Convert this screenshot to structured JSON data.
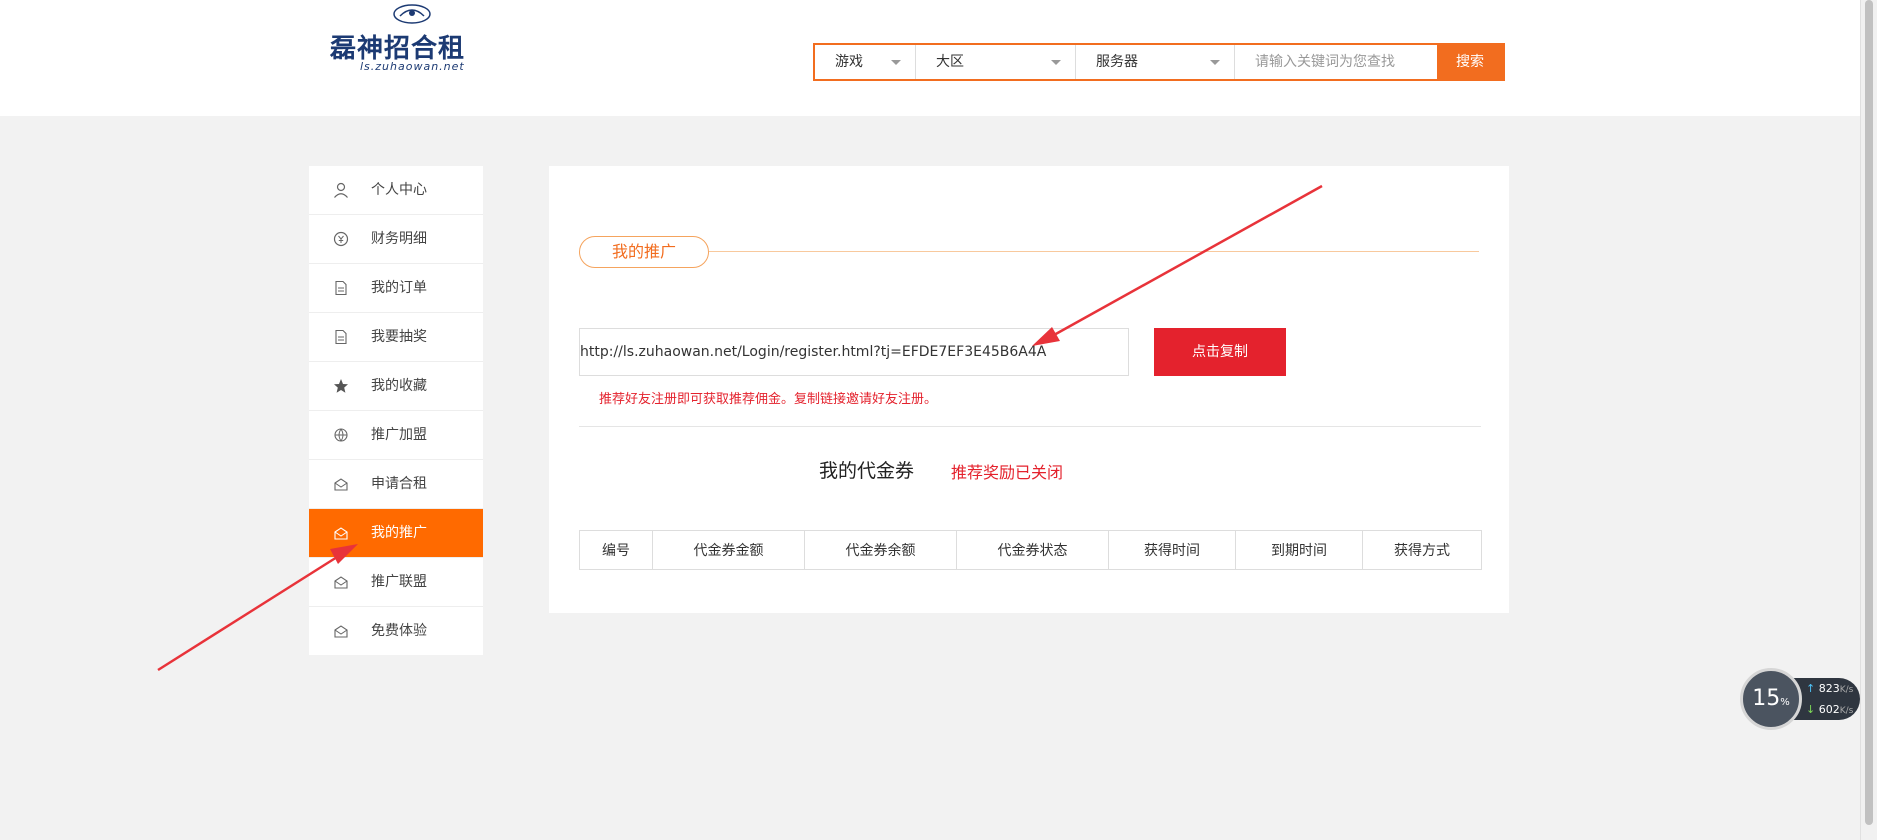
{
  "logo": {
    "text": "磊神招合租",
    "domain": "ls.zuhaowan.net"
  },
  "search": {
    "filters": [
      {
        "label": "游戏"
      },
      {
        "label": "大区"
      },
      {
        "label": "服务器"
      }
    ],
    "placeholder": "请输入关键词为您查找",
    "button": "搜索"
  },
  "sidebar": {
    "items": [
      {
        "label": "个人中心",
        "icon": "user-icon"
      },
      {
        "label": "财务明细",
        "icon": "money-icon"
      },
      {
        "label": "我的订单",
        "icon": "document-icon"
      },
      {
        "label": "我要抽奖",
        "icon": "document-icon"
      },
      {
        "label": "我的收藏",
        "icon": "star-icon"
      },
      {
        "label": "推广加盟",
        "icon": "globe-icon"
      },
      {
        "label": "申请合租",
        "icon": "envelope-icon"
      },
      {
        "label": "我的推广",
        "icon": "envelope-icon",
        "active": true
      },
      {
        "label": "推广联盟",
        "icon": "envelope-icon"
      },
      {
        "label": "免费体验",
        "icon": "envelope-icon"
      }
    ]
  },
  "promotion": {
    "title": "我的推广",
    "link": "http://ls.zuhaowan.net/Login/register.html?tj=EFDE7EF3E45B6A4A",
    "copy_button": "点击复制",
    "tip": "推荐好友注册即可获取推荐佣金。复制链接邀请好友注册。",
    "coupon_title": "我的代金券",
    "coupon_status": "推荐奖励已关闭",
    "table_headers": [
      "编号",
      "代金券金额",
      "代金券余额",
      "代金券状态",
      "获得时间",
      "到期时间",
      "获得方式"
    ]
  },
  "net_widget": {
    "cpu_value": "15",
    "cpu_unit": "%",
    "up_speed": "823",
    "down_speed": "602",
    "speed_unit": "K/s"
  },
  "colors": {
    "accent": "#ff6a00",
    "search_border": "#f26d1f",
    "copy_button": "#e4222d",
    "annotation_arrow": "#e8333a"
  }
}
